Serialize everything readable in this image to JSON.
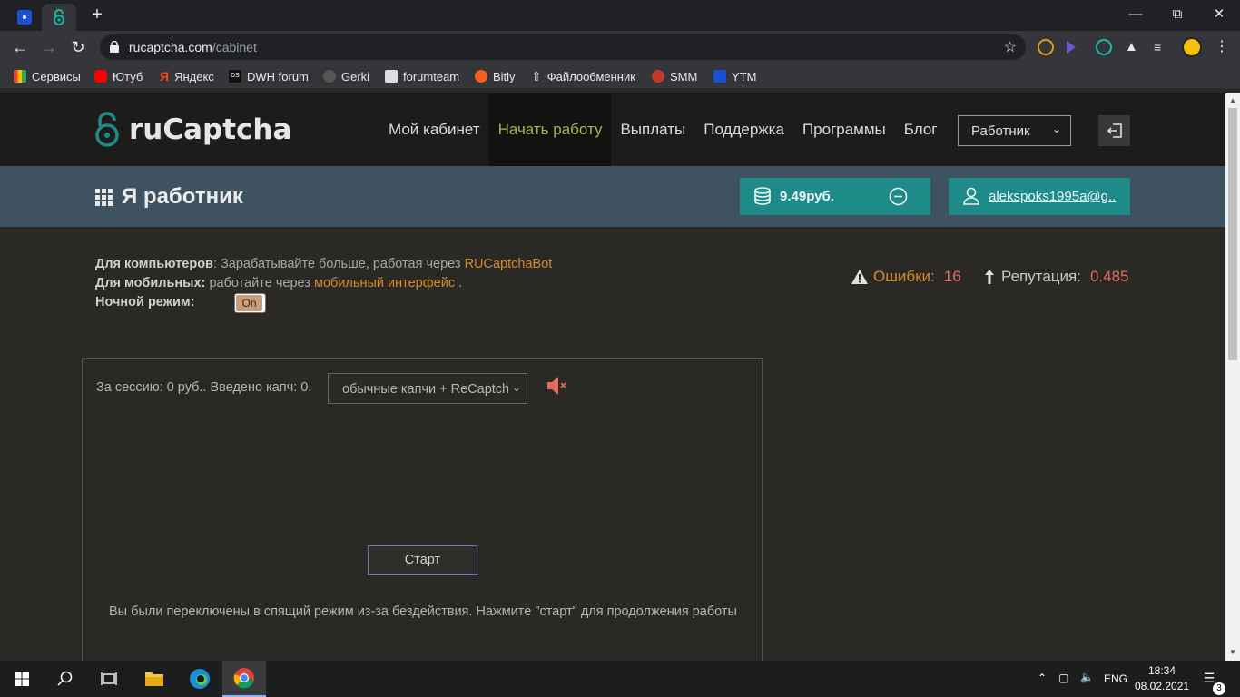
{
  "browser": {
    "url_host": "rucaptcha.com",
    "url_path": "/cabinet",
    "bookmarks": [
      "Сервисы",
      "Ютуб",
      "Яндекс",
      "DWH forum",
      "Gerki",
      "forumteam",
      "Bitly",
      "Файлообменник",
      "SMM",
      "YTM"
    ]
  },
  "header": {
    "logo": "ruCaptcha",
    "nav": [
      "Мой кабинет",
      "Начать работу",
      "Выплаты",
      "Поддержка",
      "Программы",
      "Блог"
    ],
    "active_nav": "Начать работу",
    "role": "Работник"
  },
  "subheader": {
    "title": "Я работник",
    "balance": "9.49руб.",
    "email": "alekspoks1995a@g..."
  },
  "info": {
    "computers_label": "Для компьютеров",
    "computers_text": ": Зарабатывайте больше, работая через ",
    "computers_link": "RUCaptchaBot",
    "mobile_label": "Для мобильных:",
    "mobile_text": " работайте через ",
    "mobile_link": "мобильный интерфейс",
    "mobile_end": " .",
    "night_label": "Ночной режим:",
    "night_toggle": "On"
  },
  "stats": {
    "errors_label": "Ошибки:",
    "errors_value": "16",
    "reputation_label": "Репутация:",
    "reputation_value": "0.485"
  },
  "work_panel": {
    "session_text": "За сессию:  0 руб.. Введено капч:  0.",
    "captcha_type": "обычные капчи + ReCaptcha",
    "start_label": "Старт",
    "sleep_message": "Вы были переключены в спящий режим из-за бездействия. Нажмите \"старт\" для продолжения работы"
  },
  "taskbar": {
    "lang": "ENG",
    "time": "18:34",
    "date": "08.02.2021",
    "notifications": "3"
  },
  "colors": {
    "accent_teal": "#1f8b88",
    "nav_active": "#9fb84f",
    "link_orange": "#d58a2c",
    "stat_value": "#e06c5a"
  }
}
